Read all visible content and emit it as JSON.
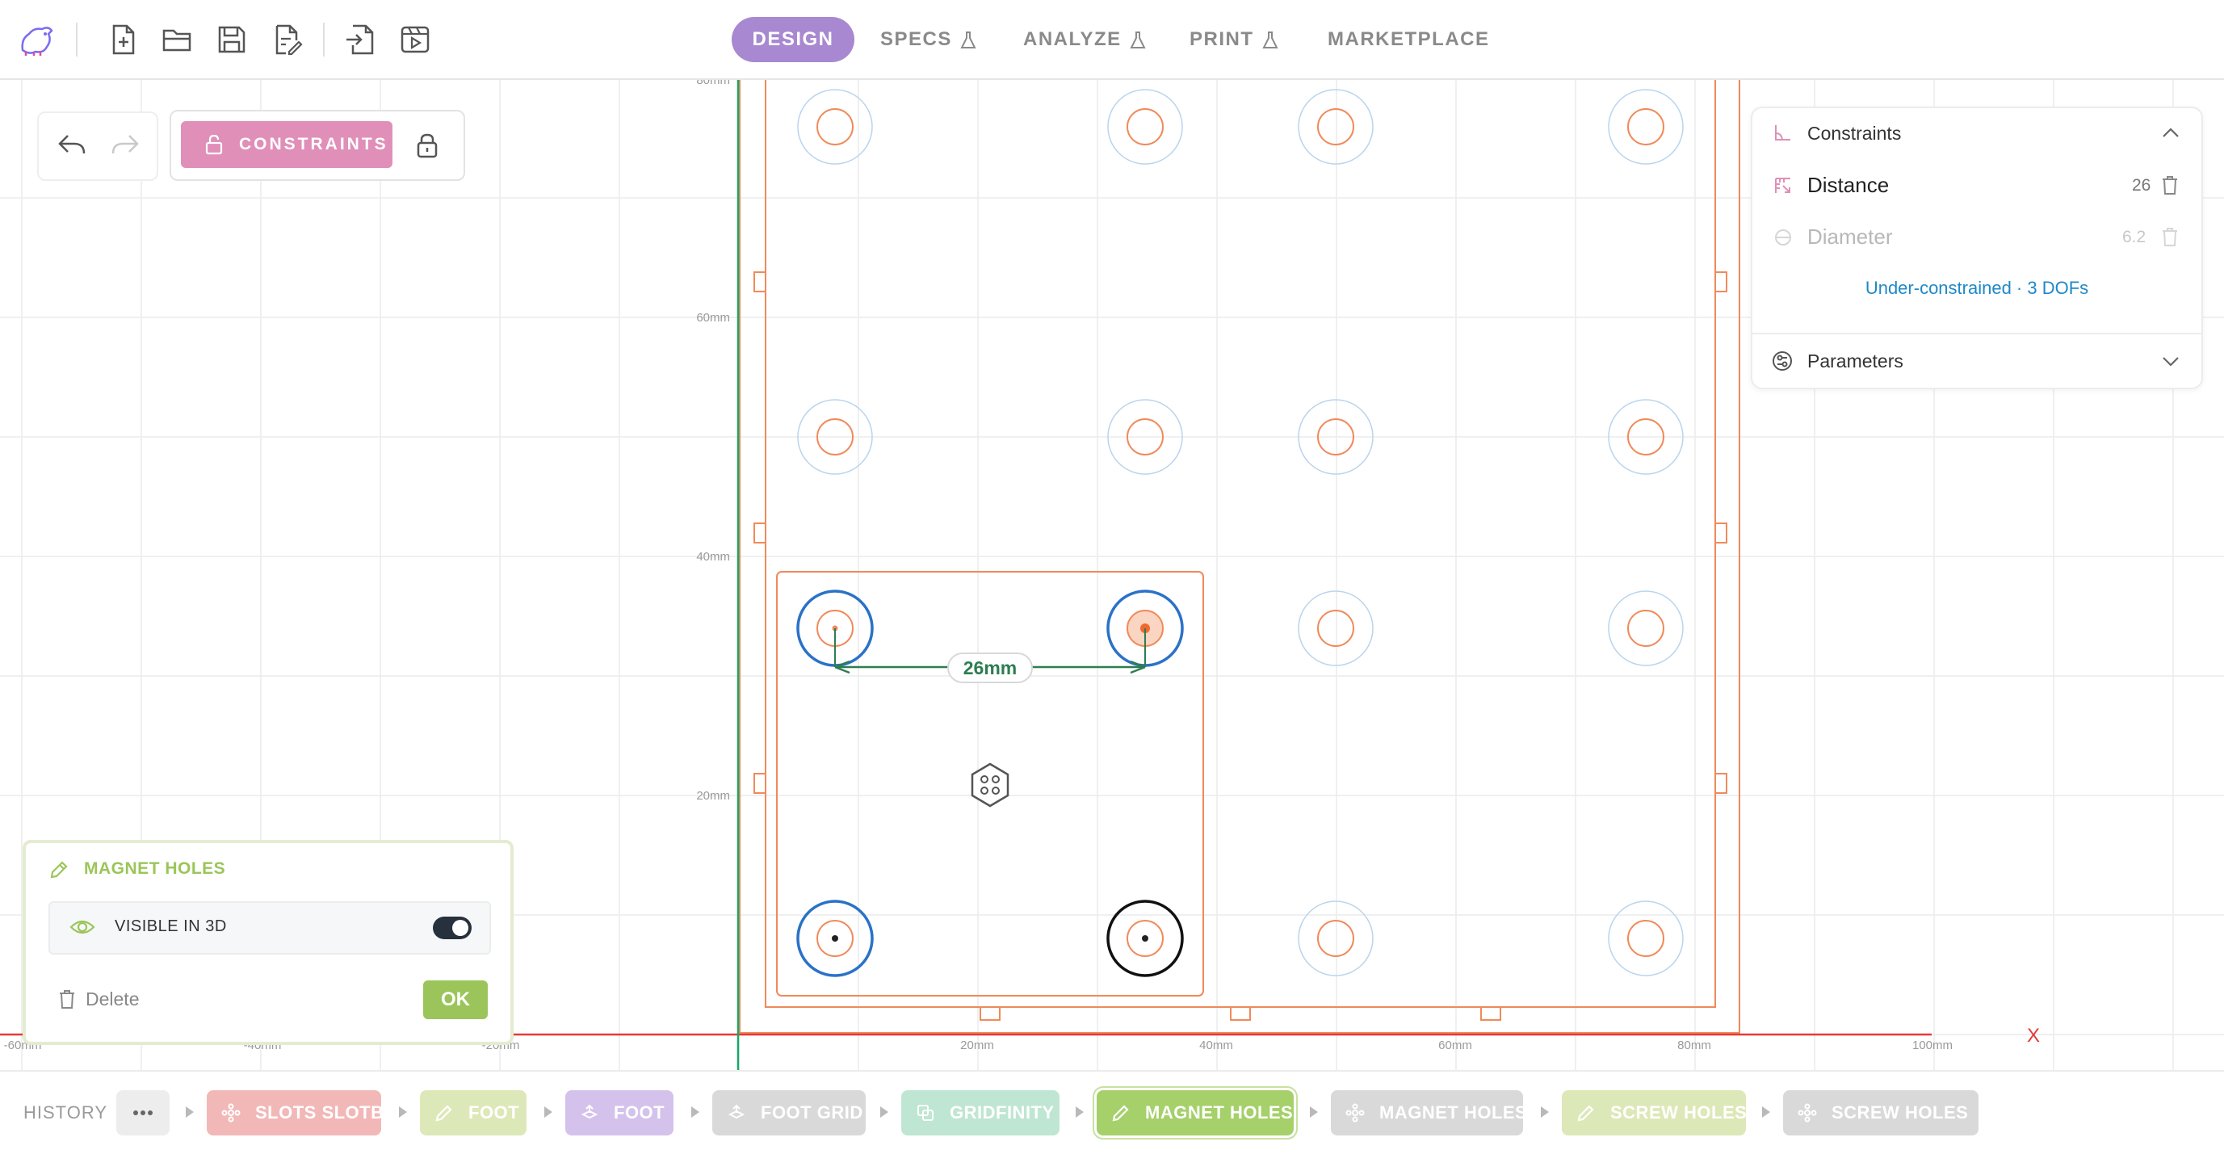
{
  "nav": {
    "tabs": [
      {
        "label": "DESIGN",
        "active": true,
        "lab": false
      },
      {
        "label": "SPECS",
        "active": false,
        "lab": true
      },
      {
        "label": "ANALYZE",
        "active": false,
        "lab": true
      },
      {
        "label": "PRINT",
        "active": false,
        "lab": true
      },
      {
        "label": "MARKETPLACE",
        "active": false,
        "lab": false
      }
    ],
    "file_icons": [
      "app-logo-icon",
      "new-file-icon",
      "open-folder-icon",
      "save-icon",
      "save-as-icon",
      "import-icon",
      "export-video-icon"
    ]
  },
  "toolbar": {
    "constraints_label": "CONSTRAINTS",
    "undo_icon": "undo-icon",
    "redo_icon": "redo-icon",
    "lock_icon": "lock-icon"
  },
  "axes": {
    "x_labels": [
      "-60mm",
      "-40mm",
      "-20mm",
      "20mm",
      "40mm",
      "60mm",
      "80mm",
      "100mm"
    ],
    "y_labels": [
      "80mm",
      "60mm",
      "40mm",
      "20mm"
    ],
    "x_axis_name": "X"
  },
  "sketch": {
    "dimension_label": "26mm"
  },
  "constraints_panel": {
    "title": "Constraints",
    "items": [
      {
        "name": "Distance",
        "value": "26",
        "active": true
      },
      {
        "name": "Diameter",
        "value": "6.2",
        "active": false
      }
    ],
    "status": "Under-constrained · 3 DOFs",
    "parameters_label": "Parameters"
  },
  "feature_panel": {
    "title": "MAGNET HOLES",
    "visible_label": "VISIBLE IN 3D",
    "visible_on": true,
    "delete_label": "Delete",
    "ok_label": "OK"
  },
  "history": {
    "label": "HISTORY",
    "more_icon": "more-icon",
    "items": [
      {
        "label": "SLOTS SLOTB",
        "color": "#f2b8b8",
        "icon": "pattern-icon"
      },
      {
        "label": "FOOT",
        "color": "#dde8b8",
        "icon": "pencil-icon"
      },
      {
        "label": "FOOT",
        "color": "#d4c2ec",
        "icon": "extrude-icon"
      },
      {
        "label": "FOOT GRID",
        "color": "#d9d9d9",
        "icon": "extrude-icon"
      },
      {
        "label": "GRIDFINITY",
        "color": "#bfe6d2",
        "icon": "copy-icon"
      },
      {
        "label": "MAGNET HOLES",
        "color": "#a5d06a",
        "icon": "pencil-icon",
        "active": true
      },
      {
        "label": "MAGNET HOLES",
        "color": "#d9d9d9",
        "icon": "pattern-icon"
      },
      {
        "label": "SCREW HOLES",
        "color": "#dde8b8",
        "icon": "pencil-icon"
      },
      {
        "label": "SCREW HOLES",
        "color": "#d9d9d9",
        "icon": "pattern-icon"
      }
    ]
  },
  "colors": {
    "accent": "#a888d0",
    "sketch_orange": "#f08a5a",
    "constraint_pink": "#e08fb8",
    "select_blue": "#2a72c8",
    "dimension_green": "#2e7d4f",
    "status_blue": "#1e88c8",
    "ok_green": "#9bc55a"
  }
}
